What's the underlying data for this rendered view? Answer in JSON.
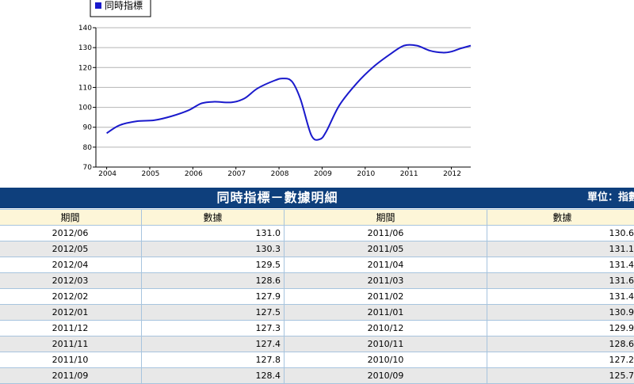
{
  "chart_data": {
    "type": "line",
    "legend": "同時指標",
    "legend_placement": "top-left",
    "line_color": "#1a1acc",
    "ylim": [
      70,
      140
    ],
    "y_ticks": [
      70,
      80,
      90,
      100,
      110,
      120,
      130,
      140
    ],
    "x_ticks": [
      "2004",
      "2005",
      "2006",
      "2007",
      "2008",
      "2009",
      "2010",
      "2011",
      "2012"
    ],
    "grid": true,
    "series": [
      {
        "name": "同時指標",
        "x": [
          2004.0,
          2004.3,
          2004.7,
          2005.1,
          2005.5,
          2005.9,
          2006.2,
          2006.5,
          2006.9,
          2007.2,
          2007.5,
          2007.9,
          2008.1,
          2008.3,
          2008.5,
          2008.75,
          2008.95,
          2009.1,
          2009.4,
          2009.8,
          2010.2,
          2010.6,
          2010.9,
          2011.2,
          2011.5,
          2011.8,
          2012.0,
          2012.2,
          2012.45
        ],
        "y": [
          87,
          91,
          93,
          93.5,
          95.5,
          98.5,
          102,
          102.8,
          102.5,
          104.5,
          109.5,
          113.5,
          114.5,
          113,
          104,
          86,
          84,
          88,
          101,
          112,
          120.5,
          127,
          131,
          131,
          128.5,
          127.5,
          128,
          129.5,
          131
        ]
      }
    ]
  },
  "banner": {
    "title": "同時指標－數據明細",
    "unit": "單位：指數"
  },
  "table": {
    "headers": [
      "期間",
      "數據",
      "期間",
      "數據"
    ],
    "rows": [
      [
        "2012/06",
        "131.0",
        "2011/06",
        "130.6"
      ],
      [
        "2012/05",
        "130.3",
        "2011/05",
        "131.1"
      ],
      [
        "2012/04",
        "129.5",
        "2011/04",
        "131.4"
      ],
      [
        "2012/03",
        "128.6",
        "2011/03",
        "131.6"
      ],
      [
        "2012/02",
        "127.9",
        "2011/02",
        "131.4"
      ],
      [
        "2012/01",
        "127.5",
        "2011/01",
        "130.9"
      ],
      [
        "2011/12",
        "127.3",
        "2010/12",
        "129.9"
      ],
      [
        "2011/11",
        "127.4",
        "2010/11",
        "128.6"
      ],
      [
        "2011/10",
        "127.8",
        "2010/10",
        "127.2"
      ],
      [
        "2011/09",
        "128.4",
        "2010/09",
        "125.7"
      ]
    ]
  }
}
